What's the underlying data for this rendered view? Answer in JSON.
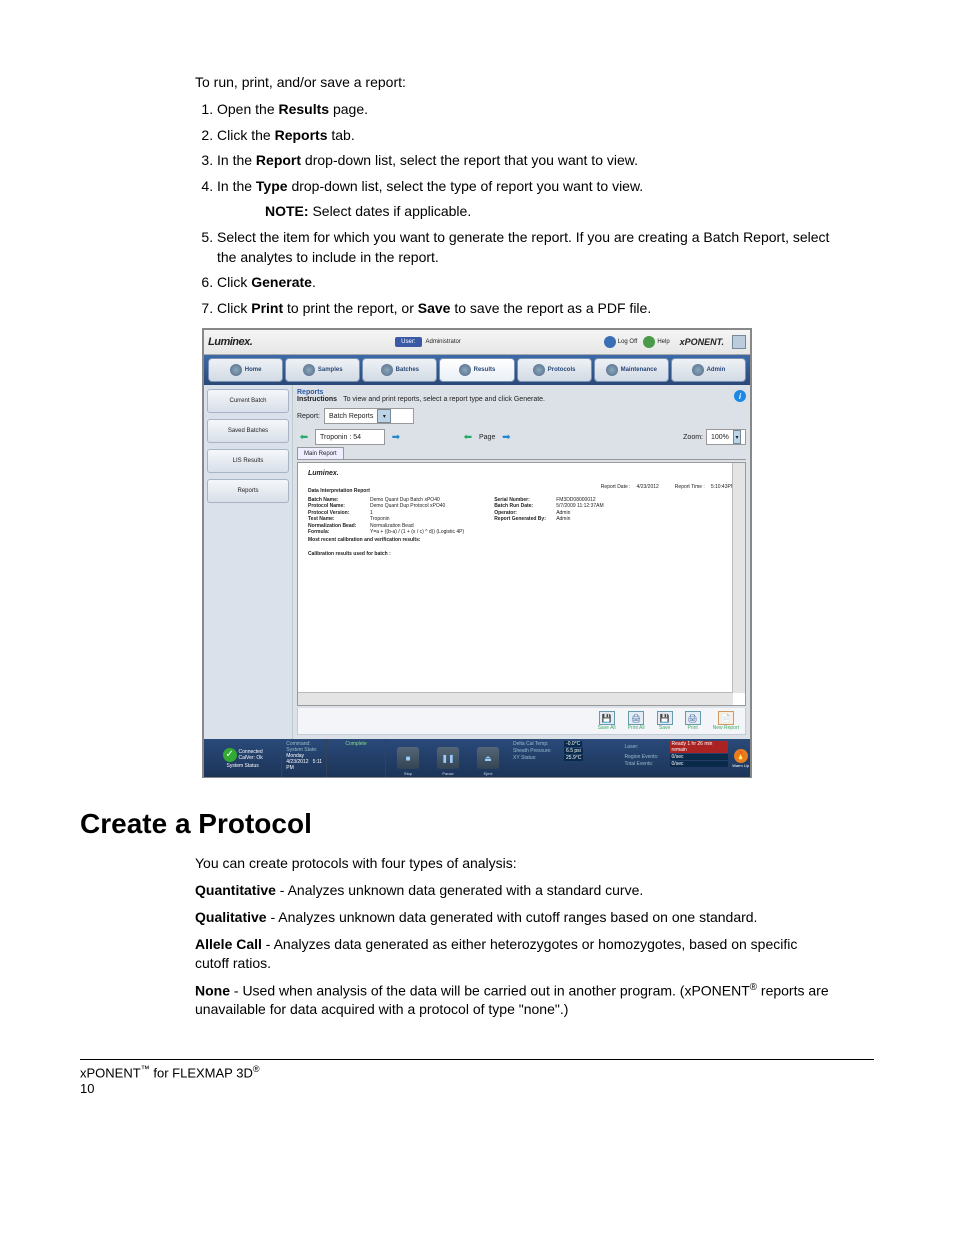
{
  "intro": "To run, print, and/or save a report:",
  "steps": {
    "s1a": "Open the ",
    "s1b": "Results",
    "s1c": " page.",
    "s2a": "Click the ",
    "s2b": "Reports",
    "s2c": " tab.",
    "s3a": "In the ",
    "s3b": "Report",
    "s3c": " drop-down list, select the report that you want to view.",
    "s4a": "In the ",
    "s4b": "Type",
    "s4c": " drop-down list, select the type of report you want to view.",
    "note_label": "NOTE:",
    "note_text": "  Select dates if applicable.",
    "s5": "Select the item for which you want to generate the report. If you are creating a Batch Report, select the analytes to include in the report.",
    "s6a": "Click ",
    "s6b": "Generate",
    "s6c": ".",
    "s7a": "Click ",
    "s7b": "Print",
    "s7c": " to print the report, or ",
    "s7d": "Save",
    "s7e": " to save the report as a PDF file."
  },
  "app": {
    "logo": "Luminex.",
    "user_label": "User:",
    "user_value": "Administrator",
    "logoff": "Log Off",
    "help": "Help",
    "brand": "xPONENT.",
    "tabs": [
      "Home",
      "Samples",
      "Batches",
      "Results",
      "Protocols",
      "Maintenance",
      "Admin"
    ],
    "active_tab_index": 3,
    "side": [
      "Current Batch",
      "Saved Batches",
      "LIS Results",
      "Reports"
    ],
    "panel_title": "Reports",
    "instructions_label": "Instructions",
    "instructions_text": "To view and print reports, select a report type and click Generate.",
    "report_label": "Report:",
    "report_value": "Batch Reports",
    "type_value": "Troponin : 54",
    "page_label": "Page",
    "zoom_label": "Zoom:",
    "zoom_value": "100%",
    "report_tab": "Main Report",
    "report": {
      "brand": "Luminex.",
      "title": "Data Interpretation Report",
      "date_label": "Report Date :",
      "date_value": "4/23/2012",
      "time_label": "Report Time :",
      "time_value": "5:10:43PM",
      "left": [
        {
          "k": "Batch Name:",
          "v": "Demo Quant Dup Batch xPO40"
        },
        {
          "k": "Protocol Name:",
          "v": "Demo Quant Dup Protocol xPO40"
        },
        {
          "k": "Protocol Version:",
          "v": "1"
        },
        {
          "k": "Test Name:",
          "v": "Troponin"
        },
        {
          "k": "Normalization Bead:",
          "v": "Normalization Bead"
        },
        {
          "k": "Formula:",
          "v": "Y=a + ((b-a) / (1 + (x / c) ^ d))  (Logistic 4P)"
        }
      ],
      "right": [
        {
          "k": "Serial Number:",
          "v": "FM3DD08000012"
        },
        {
          "k": "Batch Run Date:",
          "v": "5/7/2009  11:12:37AM"
        },
        {
          "k": "Operator:",
          "v": "Admin"
        },
        {
          "k": "Report Generated By:",
          "v": "Admin"
        }
      ],
      "line1": "Most recent calibration and verification results:",
      "line2": "Calibration results used for batch :"
    },
    "actions": [
      "Save All",
      "Print All",
      "Save",
      "Print",
      "New Report"
    ],
    "status": {
      "connected": "Connected",
      "calver": "CalVer: Ok",
      "sys_status": "System Status",
      "command": "Command:",
      "complete": "Complete",
      "sys_state": "System State:",
      "date": "Monday 4/23/2012",
      "time": "5:11 PM",
      "btns": [
        "Stop",
        "Pause",
        "Eject"
      ],
      "dct_k": "Delta Cal Temp:",
      "dct_v": "-0.0°C",
      "sp_k": "Sheath Pressure:",
      "sp_v": "6.5 psi",
      "xy_k": "XY Status:",
      "xy_v": "25.9°C",
      "laser_k": "Laser:",
      "laser_v": "Ready  1 hr 26 min remain",
      "re_k": "Region Events:",
      "re_v": "0/sec",
      "te_k": "Total Events:",
      "te_v": "0/sec",
      "warm": "Warm Up"
    }
  },
  "section_title": "Create a Protocol",
  "section": {
    "p1": "You can create protocols with four types of analysis:",
    "q1a": "Quantitative",
    "q1b": " - Analyzes unknown data generated with a standard curve.",
    "q2a": "Qualitative",
    "q2b": " - Analyzes unknown data generated with cutoff ranges based on one standard.",
    "q3a": "Allele Call",
    "q3b": " - Analyzes data generated as either heterozygotes or homozygotes, based on specific cutoff ratios.",
    "q4a": "None",
    "q4b": " - Used when analysis of the data will be carried out in another program. (xPONENT",
    "q4c": " reports are unavailable for data acquired with a protocol of type \"none\".)"
  },
  "footer": {
    "line1a": "xPONENT",
    "line1b": " for FLEXMAP 3D",
    "page": "10"
  }
}
